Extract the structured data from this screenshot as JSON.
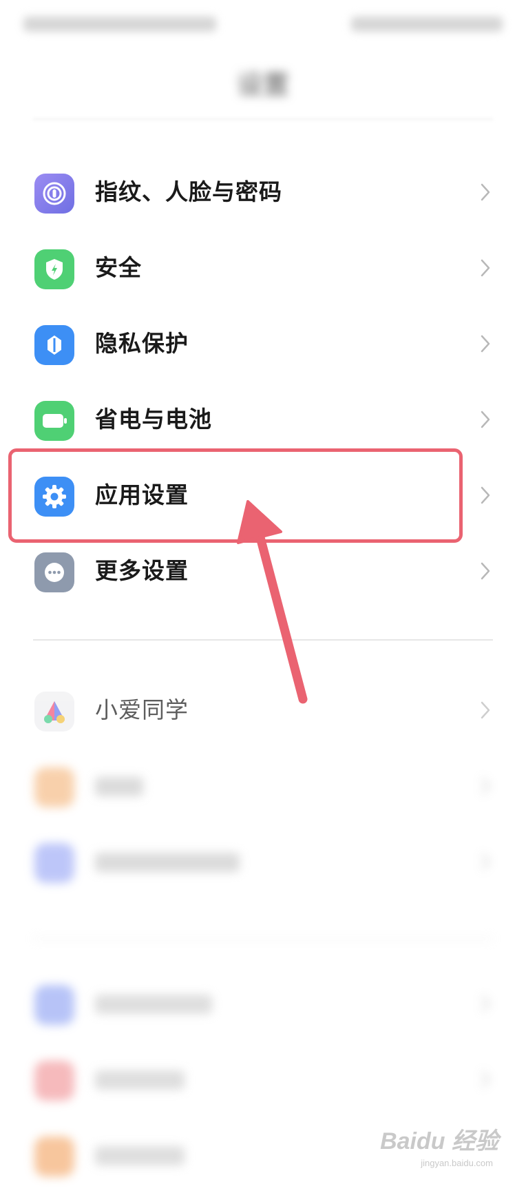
{
  "header": {
    "title": "设置"
  },
  "settings": {
    "items": [
      {
        "label": "指纹、人脸与密码",
        "icon": "fingerprint-icon",
        "color": "#8b7be8"
      },
      {
        "label": "安全",
        "icon": "security-shield-icon",
        "color": "#49cf72"
      },
      {
        "label": "隐私保护",
        "icon": "privacy-icon",
        "color": "#3d8ff5"
      },
      {
        "label": "省电与电池",
        "icon": "battery-icon",
        "color": "#49cf72"
      },
      {
        "label": "应用设置",
        "icon": "gear-icon",
        "color": "#3d8ff5"
      },
      {
        "label": "更多设置",
        "icon": "more-dots-icon",
        "color": "#8e9aad"
      },
      {
        "label": "小爱同学",
        "icon": "xiaoai-icon",
        "color": "#f3f3f3"
      }
    ]
  },
  "annotation": {
    "highlighted_item": "应用设置"
  },
  "watermark": {
    "brand": "Baidu 经验",
    "url": "jingyan.baidu.com"
  }
}
